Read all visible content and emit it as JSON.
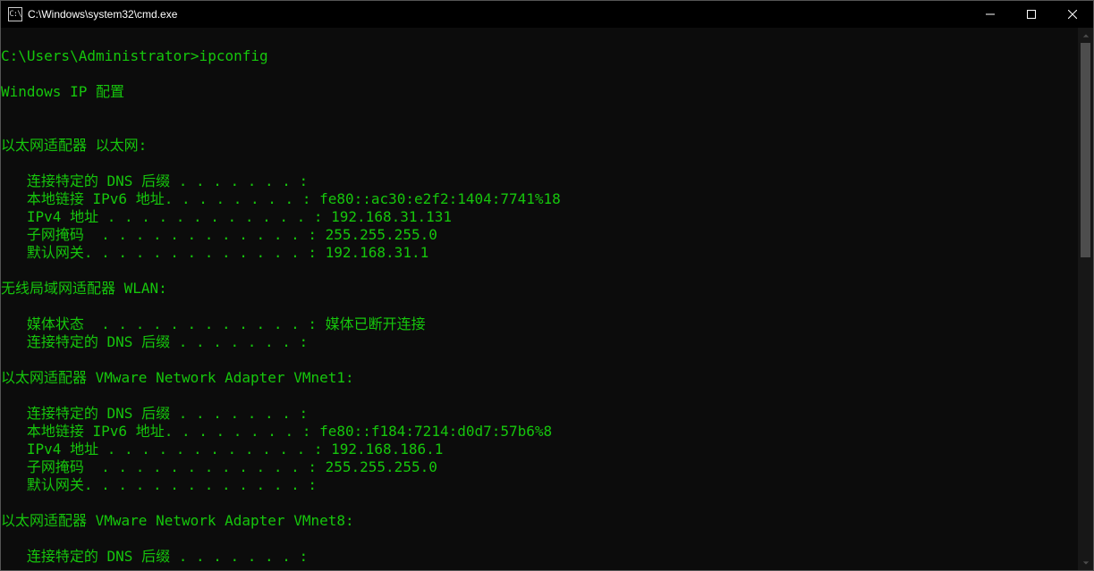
{
  "titlebar": {
    "icon_text": "C:\\",
    "title": "C:\\Windows\\system32\\cmd.exe"
  },
  "terminal": {
    "prompt_line": "C:\\Users\\Administrator>ipconfig",
    "header": "Windows IP 配置",
    "sections": [
      {
        "title": "以太网适配器 以太网:",
        "lines": [
          "   连接特定的 DNS 后缀 . . . . . . . :",
          "   本地链接 IPv6 地址. . . . . . . . : fe80::ac30:e2f2:1404:7741%18",
          "   IPv4 地址 . . . . . . . . . . . . : 192.168.31.131",
          "   子网掩码  . . . . . . . . . . . . : 255.255.255.0",
          "   默认网关. . . . . . . . . . . . . : 192.168.31.1"
        ]
      },
      {
        "title": "无线局域网适配器 WLAN:",
        "lines": [
          "   媒体状态  . . . . . . . . . . . . : 媒体已断开连接",
          "   连接特定的 DNS 后缀 . . . . . . . :"
        ]
      },
      {
        "title": "以太网适配器 VMware Network Adapter VMnet1:",
        "lines": [
          "   连接特定的 DNS 后缀 . . . . . . . :",
          "   本地链接 IPv6 地址. . . . . . . . : fe80::f184:7214:d0d7:57b6%8",
          "   IPv4 地址 . . . . . . . . . . . . : 192.168.186.1",
          "   子网掩码  . . . . . . . . . . . . : 255.255.255.0",
          "   默认网关. . . . . . . . . . . . . :"
        ]
      },
      {
        "title": "以太网适配器 VMware Network Adapter VMnet8:",
        "lines": [
          "   连接特定的 DNS 后缀 . . . . . . . :"
        ]
      }
    ]
  }
}
